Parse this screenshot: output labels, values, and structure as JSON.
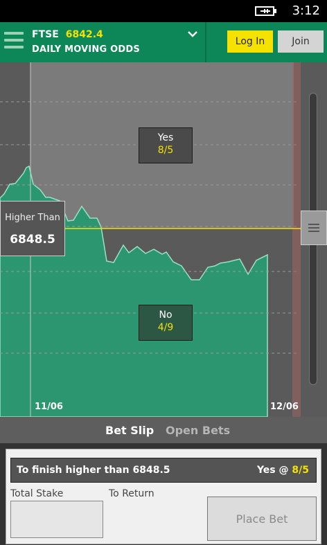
{
  "status": {
    "time": "3:12",
    "icon": "battery-charging-icon"
  },
  "header": {
    "market_name": "FTSE",
    "price": "6842.4",
    "subtitle": "DAILY MOVING ODDS",
    "login_label": "Log In",
    "join_label": "Join",
    "accent": "#0d8757",
    "highlight": "#f5e200"
  },
  "chart": {
    "yes_label": "Yes",
    "yes_odds": "8/5",
    "no_label": "No",
    "no_odds": "4/9",
    "higher_label": "Higher Than",
    "higher_value": "6848.5",
    "x_labels": [
      "11/06",
      "12/06"
    ]
  },
  "tabs": {
    "bet_slip": "Bet Slip",
    "open_bets": "Open Bets"
  },
  "slip": {
    "selection": "To finish higher than 6848.5",
    "pick": "Yes @ ",
    "odds": "8/5",
    "total_stake_label": "Total Stake",
    "to_return_label": "To Return",
    "place_bet_label": "Place Bet"
  }
}
